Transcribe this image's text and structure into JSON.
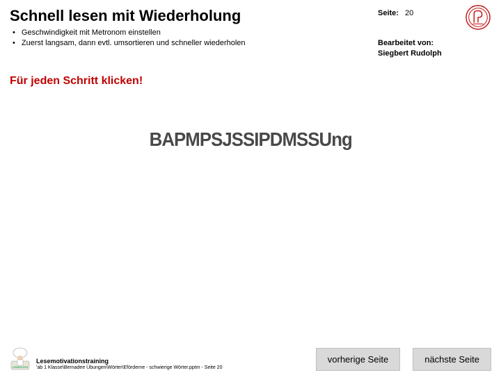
{
  "header": {
    "title": "Schnell lesen mit Wiederholung",
    "bullets": [
      "Geschwindigkeit mit Metronom einstellen",
      "Zuerst langsam, dann evtl. umsortieren und schneller wiederholen"
    ]
  },
  "meta": {
    "page_label": "Seite:",
    "page_number": "20",
    "edited_label": "Bearbeitet von:",
    "editor": "Siegbert Rudolph"
  },
  "subheader": "Für jeden Schritt klicken!",
  "center_overlay": "BAPMPSJSSIPDMSSUng",
  "footer": {
    "line1": "Lesemotivationstraining",
    "line2": "'ab 1  Klasse\\Bernadee  Übungen\\Wörter\\Eförderne  - schwierige Wörter.pptm  - Seite 20"
  },
  "nav": {
    "prev": "vorherige Seite",
    "next": "nächste Seite"
  }
}
